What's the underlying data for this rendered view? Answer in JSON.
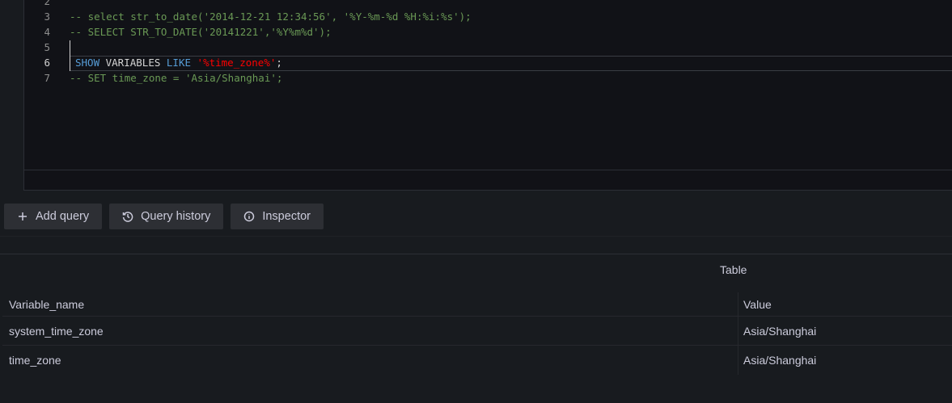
{
  "editor": {
    "lines": [
      {
        "num": "2",
        "tokens": []
      },
      {
        "num": "3",
        "tokens": [
          {
            "cls": "comment",
            "text": "-- select str_to_date('2014-12-21 12:34:56', '%Y-%m-%d %H:%i:%s');"
          }
        ]
      },
      {
        "num": "4",
        "tokens": [
          {
            "cls": "comment",
            "text": "-- SELECT STR_TO_DATE('20141221','%Y%m%d');"
          }
        ]
      },
      {
        "num": "5",
        "tokens": []
      },
      {
        "num": "6",
        "tokens": [
          {
            "cls": "kw",
            "text": "SHOW"
          },
          {
            "cls": "ident",
            "text": " VARIABLES "
          },
          {
            "cls": "kw",
            "text": "LIKE"
          },
          {
            "cls": "punc",
            "text": " "
          },
          {
            "cls": "str",
            "text": "'%time_zone%'"
          },
          {
            "cls": "punc",
            "text": ";"
          }
        ]
      },
      {
        "num": "7",
        "tokens": [
          {
            "cls": "comment",
            "text": "-- SET time_zone = 'Asia/Shanghai';"
          }
        ]
      }
    ],
    "active_line": "6"
  },
  "toolbar": {
    "add_query_label": "Add query",
    "query_history_label": "Query history",
    "inspector_label": "Inspector"
  },
  "panel": {
    "title": "Table",
    "columns": [
      "Variable_name",
      "Value"
    ],
    "rows": [
      [
        "system_time_zone",
        "Asia/Shanghai"
      ],
      [
        "time_zone",
        "Asia/Shanghai"
      ]
    ]
  }
}
